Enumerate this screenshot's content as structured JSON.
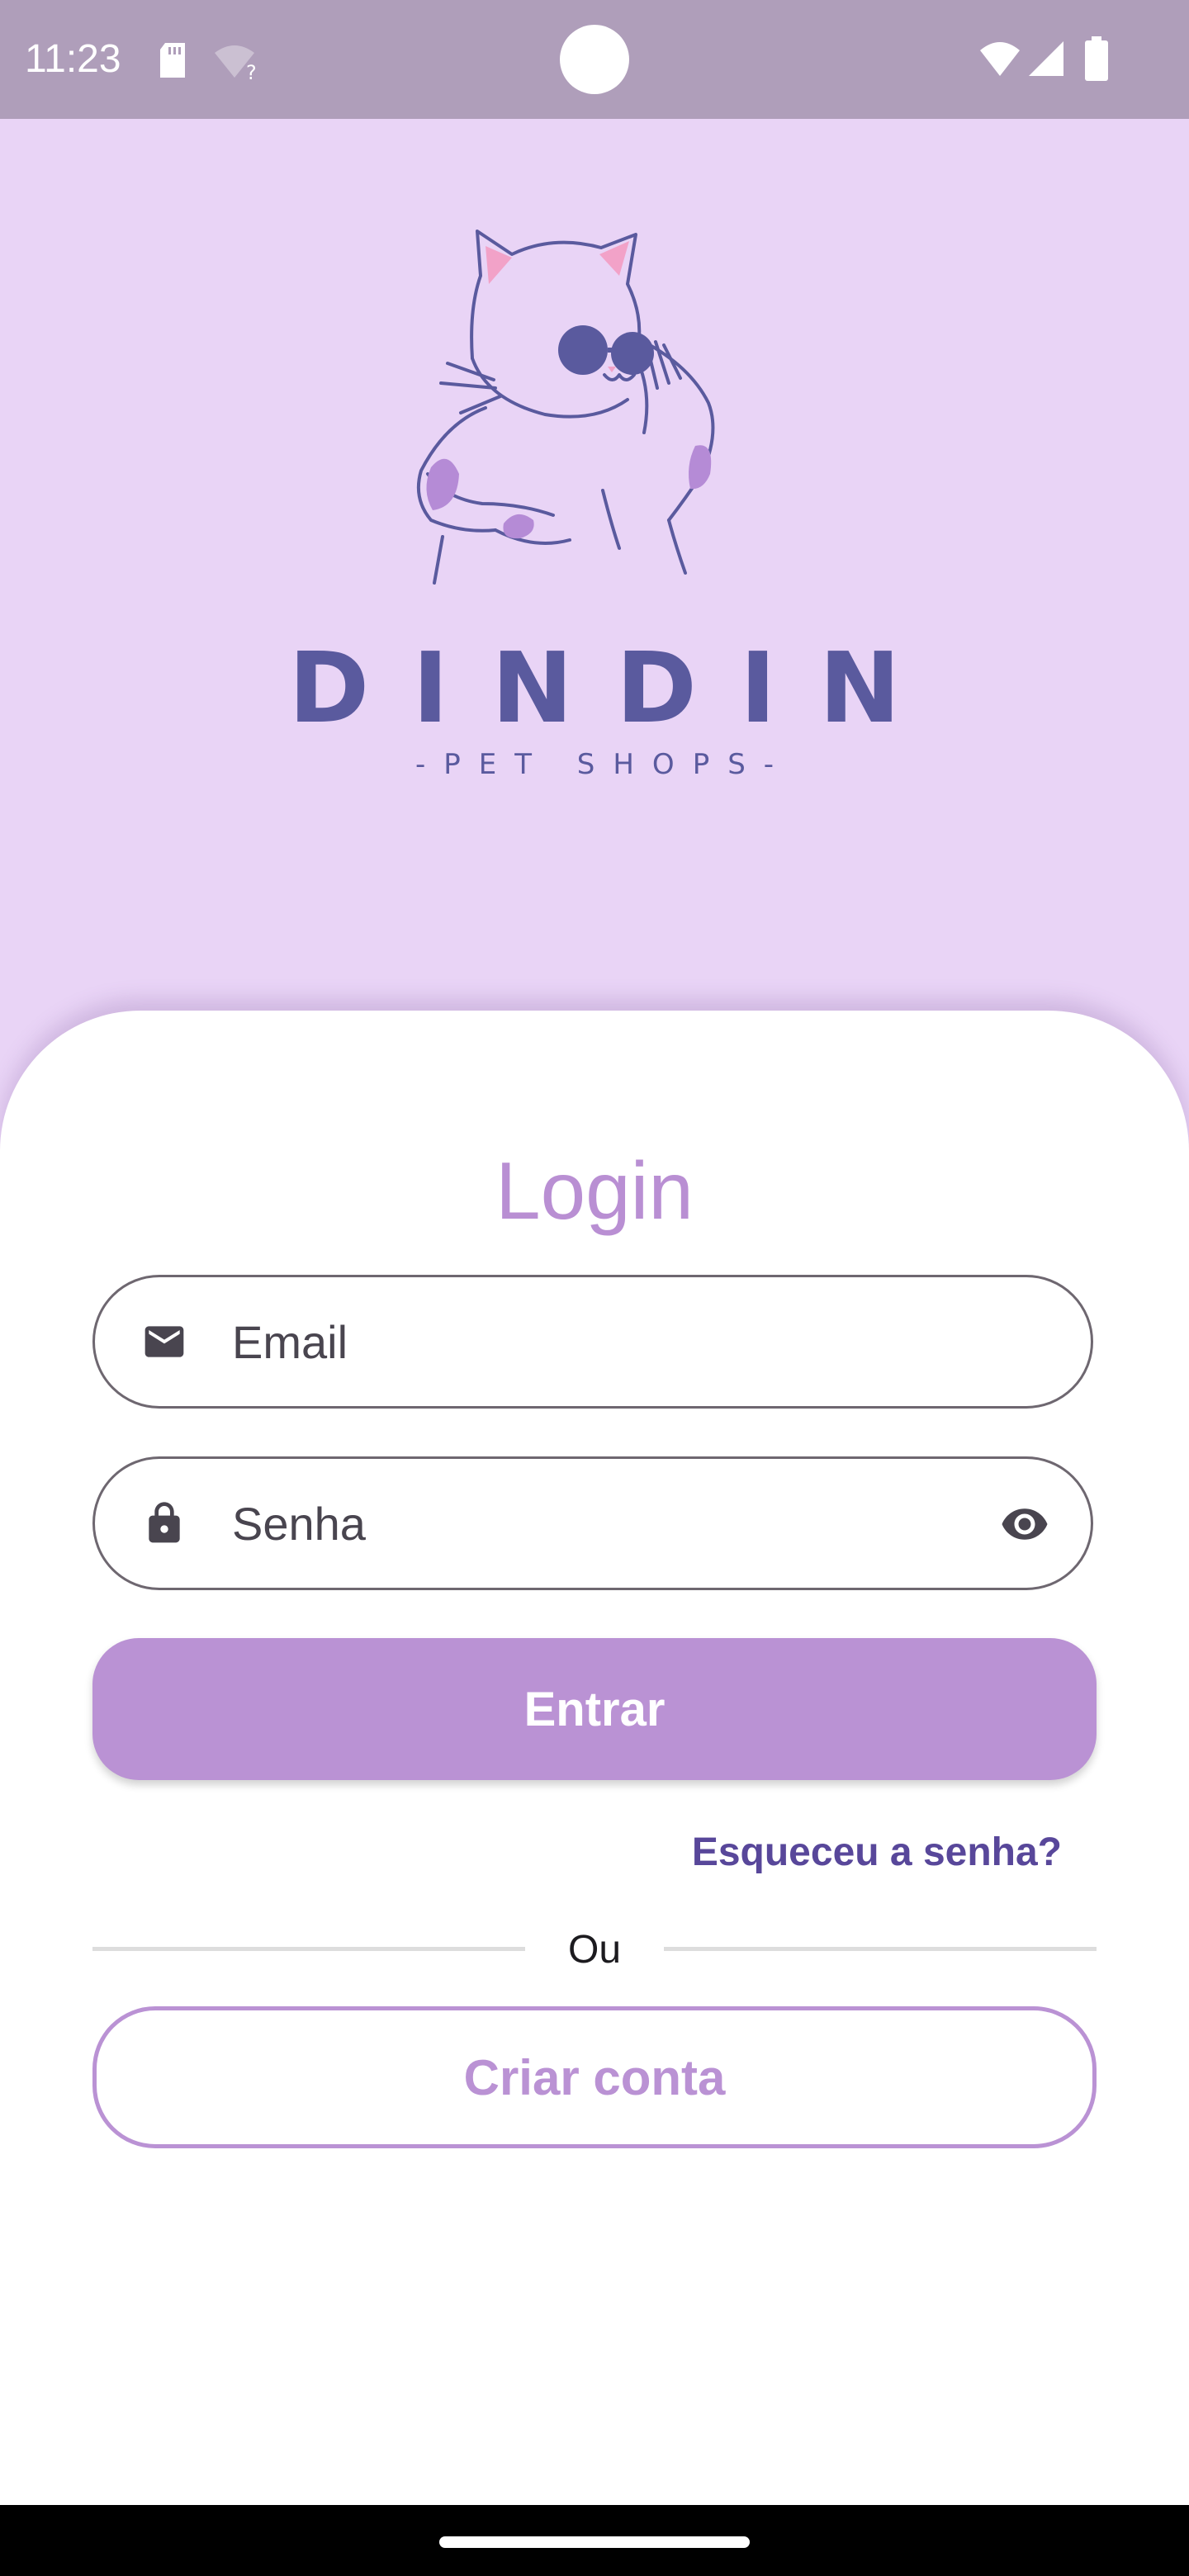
{
  "status_bar": {
    "time": "11:23",
    "icons": [
      "sd-card-icon",
      "wifi-unknown-icon",
      "wifi-icon",
      "cell-signal-icon",
      "battery-icon"
    ]
  },
  "brand": {
    "name": "DINDIN",
    "tagline": "-PET SHOPS-",
    "colors": {
      "ink": "#5A5A9E",
      "spots": "#B58BD6",
      "ears": "#F2A2C8"
    }
  },
  "login": {
    "title": "Login",
    "email_placeholder": "Email",
    "password_placeholder": "Senha",
    "submit_label": "Entrar",
    "forgot_label": "Esqueceu a senha?",
    "divider_label": "Ou",
    "create_account_label": "Criar conta"
  },
  "colors": {
    "background": "#E9D4F6",
    "status_bar": "#AF9EBA",
    "accent": "#BA92D4",
    "link": "#58479A"
  }
}
